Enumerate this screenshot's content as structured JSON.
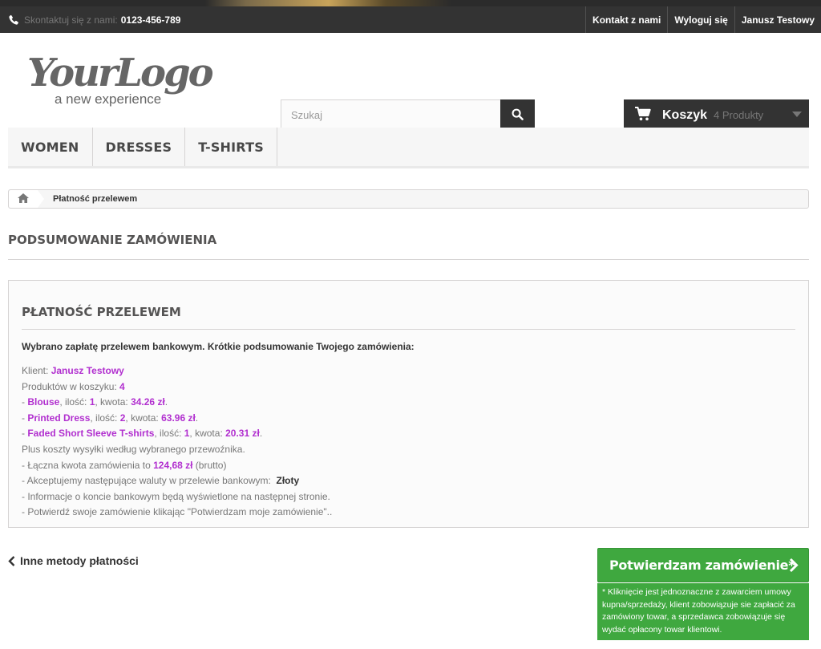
{
  "topbar": {
    "contact_label": "Skontaktuj się z nami:",
    "phone": "0123-456-789",
    "links": [
      "Kontakt z nami",
      "Wyloguj się",
      "Janusz Testowy"
    ]
  },
  "header": {
    "logo_text": "YourLogo",
    "logo_tagline": "a new experience",
    "search_placeholder": "Szukaj",
    "cart_label": "Koszyk",
    "cart_count": "4 Produkty"
  },
  "menu": [
    "Women",
    "Dresses",
    "T-shirts"
  ],
  "breadcrumb": {
    "current": "Płatność przelewem"
  },
  "page_heading": "Podsumowanie zamówienia",
  "payment": {
    "heading": "Płatność przelewem",
    "intro": "Wybrano zapłatę przelewem bankowym. Krótkie podsumowanie Twojego zamówienia:",
    "client_label": "Klient: ",
    "client_name": "Janusz Testowy",
    "products_label": "Produktów w koszyku: ",
    "products_count": "4",
    "items": [
      {
        "name": "Blouse",
        "qty_label": ", ilość: ",
        "qty": "1",
        "amount_label": ", kwota: ",
        "amount": "34.26 zł",
        "end": "."
      },
      {
        "name": "Printed Dress",
        "qty_label": ", ilość: ",
        "qty": "2",
        "amount_label": ", kwota: ",
        "amount": "63.96 zł",
        "end": "."
      },
      {
        "name": "Faded Short Sleeve T-shirts",
        "qty_label": ", ilość: ",
        "qty": "1",
        "amount_label": ", kwota: ",
        "amount": "20.31 zł",
        "end": "."
      }
    ],
    "shipping_note": "Plus koszty wysyłki według wybranego przewoźnika.",
    "total_label": "- Łączna kwota zamówienia to ",
    "total_value": "124,68 zł",
    "total_suffix": " (brutto)",
    "currency_label": "- Akceptujemy następujące waluty w przelewie bankowym:  ",
    "currency_value": "Złoty",
    "bank_info": "- Informacje o koncie bankowym będą wyświetlone na następnej stronie.",
    "confirm_info": "- Potwierdź swoje zamówienie klikając \"Potwierdzam moje zamówienie\".."
  },
  "back_link": "Inne metody płatności",
  "confirm_button": "Potwierdzam zamówienie*",
  "confirm_note": "* Kliknięcie jest jednoznaczne z zawarciem umowy kupna/sprzedaży, klient zobowiązuje sie zapłacić za zamówiony towar, a sprzedawca zobowiązuje się wydać opłacony towar klientowi.",
  "colors": {
    "accent_purple": "#b12fcf",
    "confirm_green": "#3fa83f",
    "dark_bar": "#333333"
  }
}
